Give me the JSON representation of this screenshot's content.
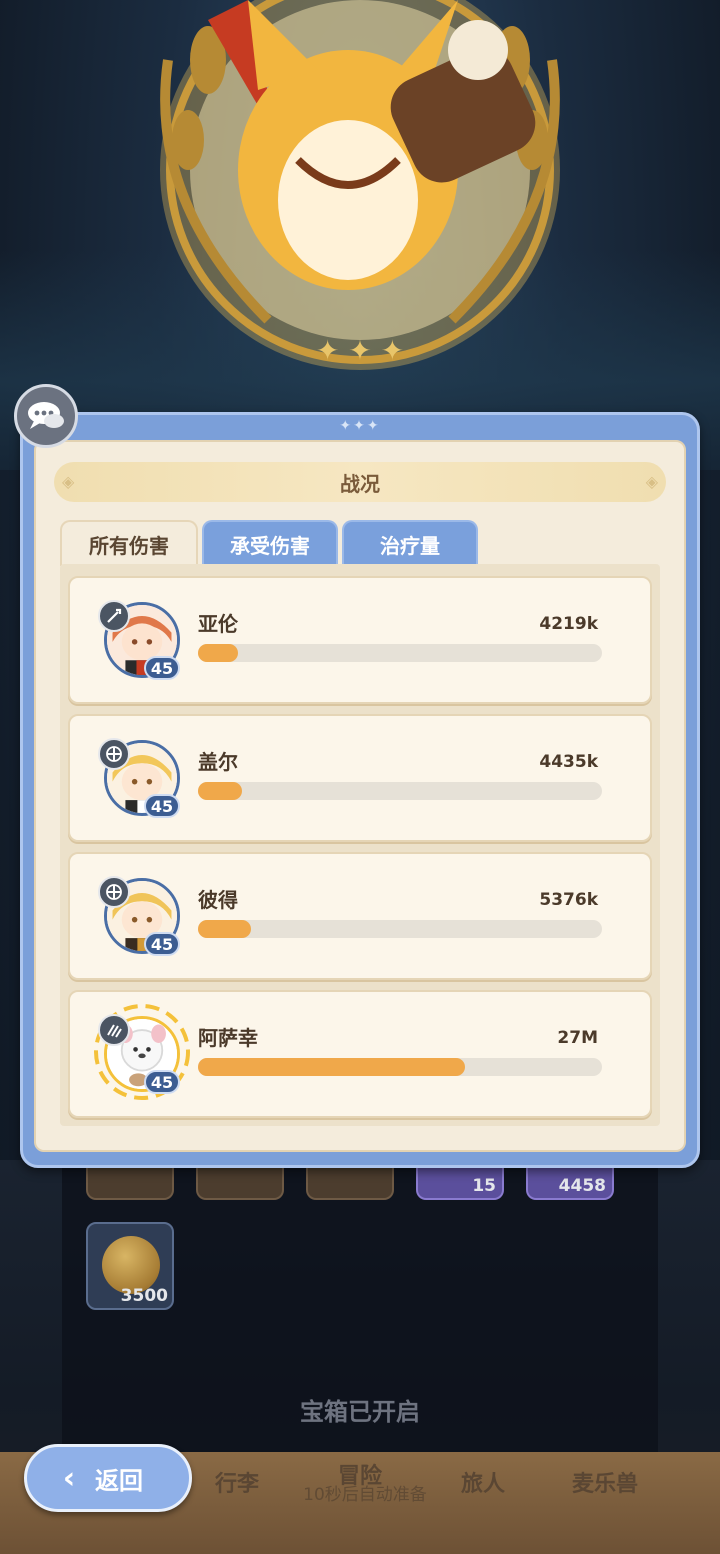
{
  "header": {
    "title": "战况"
  },
  "tabs": [
    {
      "label": "所有伤害",
      "active": true
    },
    {
      "label": "承受伤害",
      "active": false
    },
    {
      "label": "治疗量",
      "active": false
    }
  ],
  "heroes": [
    {
      "name": "亚伦",
      "value": "4219k",
      "level": "45",
      "class_icon": "sword-icon",
      "fill": 0.1
    },
    {
      "name": "盖尔",
      "value": "4435k",
      "level": "45",
      "class_icon": "shield-cross-icon",
      "fill": 0.11
    },
    {
      "name": "彼得",
      "value": "5376k",
      "level": "45",
      "class_icon": "shield-cross-icon",
      "fill": 0.13
    },
    {
      "name": "阿萨幸",
      "value": "27M",
      "level": "45",
      "class_icon": "claw-icon",
      "fill": 0.66
    }
  ],
  "background": {
    "slots": [
      {
        "num": ""
      },
      {
        "num": ""
      },
      {
        "num": ""
      },
      {
        "num": "15"
      },
      {
        "num": "4458"
      }
    ],
    "coin_count": "3500",
    "chest_status": "宝箱已开启"
  },
  "bottom_nav": {
    "tabs": [
      "行李",
      "冒险",
      "旅人",
      "麦乐兽"
    ],
    "subtitle": "10秒后自动准备"
  },
  "back_button": {
    "label": "返回"
  },
  "colors": {
    "accent": "#f0a84a",
    "panel_blue": "#7b9fd9",
    "card_bg": "#fcf6ea"
  }
}
